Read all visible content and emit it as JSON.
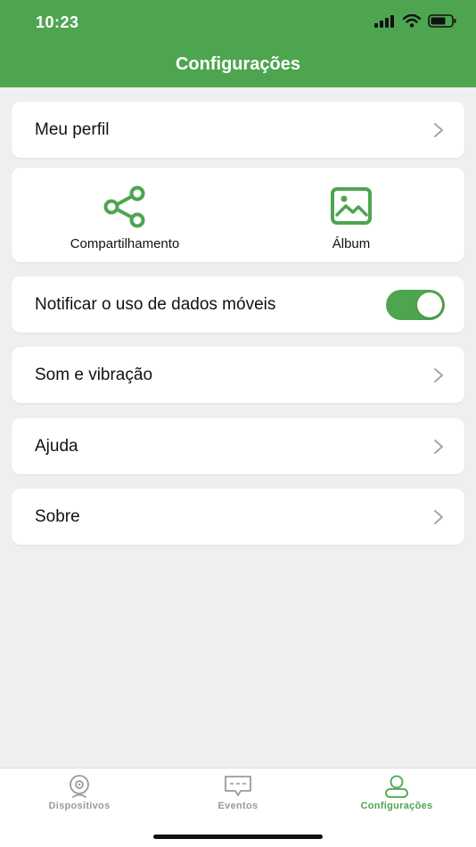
{
  "status": {
    "time": "10:23"
  },
  "header": {
    "title": "Configurações"
  },
  "menu": {
    "profile": "Meu perfil",
    "share": "Compartilhamento",
    "album": "Álbum",
    "notify_mobile_data": "Notificar o uso de dados móveis",
    "notify_mobile_data_on": true,
    "sound": "Som e vibração",
    "help": "Ajuda",
    "about": "Sobre"
  },
  "tabs": [
    {
      "label": "Dispositivos",
      "icon": "camera-icon",
      "active": false
    },
    {
      "label": "Eventos",
      "icon": "message-icon",
      "active": false
    },
    {
      "label": "Configurações",
      "icon": "user-icon",
      "active": true
    }
  ],
  "colors": {
    "accent": "#4ea550",
    "background": "#efefef",
    "inactive": "#9a9a9a"
  }
}
